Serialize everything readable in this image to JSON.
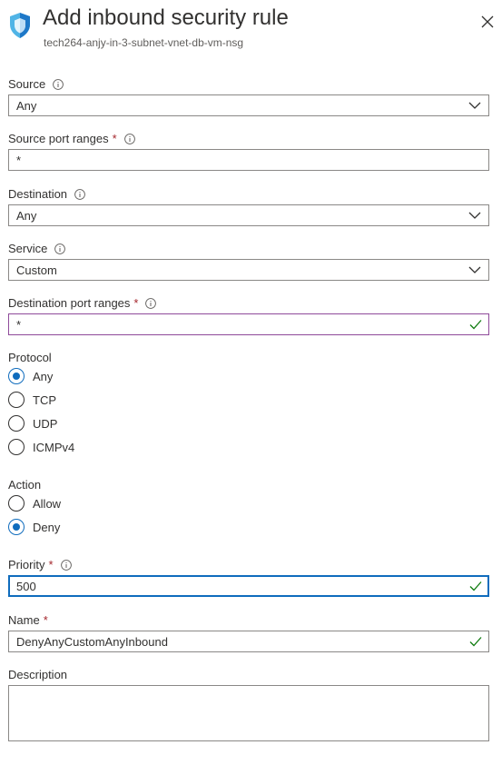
{
  "header": {
    "title": "Add inbound security rule",
    "subtitle": "tech264-anjy-in-3-subnet-vnet-db-vm-nsg",
    "icon": "shield-icon",
    "close_icon": "close-icon"
  },
  "colors": {
    "accent": "#0f6cbd",
    "required": "#a4262c",
    "valid_check": "#107c10",
    "modified_border": "#8f4a9a"
  },
  "form": {
    "source": {
      "label": "Source",
      "value": "Any"
    },
    "source_port_ranges": {
      "label": "Source port ranges",
      "required": "*",
      "value": "*"
    },
    "destination": {
      "label": "Destination",
      "value": "Any"
    },
    "service": {
      "label": "Service",
      "value": "Custom"
    },
    "destination_port_ranges": {
      "label": "Destination port ranges",
      "required": "*",
      "value": "*"
    },
    "protocol": {
      "label": "Protocol",
      "options": [
        "Any",
        "TCP",
        "UDP",
        "ICMPv4"
      ],
      "selected": "Any"
    },
    "action": {
      "label": "Action",
      "options": [
        "Allow",
        "Deny"
      ],
      "selected": "Deny"
    },
    "priority": {
      "label": "Priority",
      "required": "*",
      "value": "500"
    },
    "name": {
      "label": "Name",
      "required": "*",
      "value": "DenyAnyCustomAnyInbound"
    },
    "description": {
      "label": "Description",
      "value": ""
    }
  }
}
